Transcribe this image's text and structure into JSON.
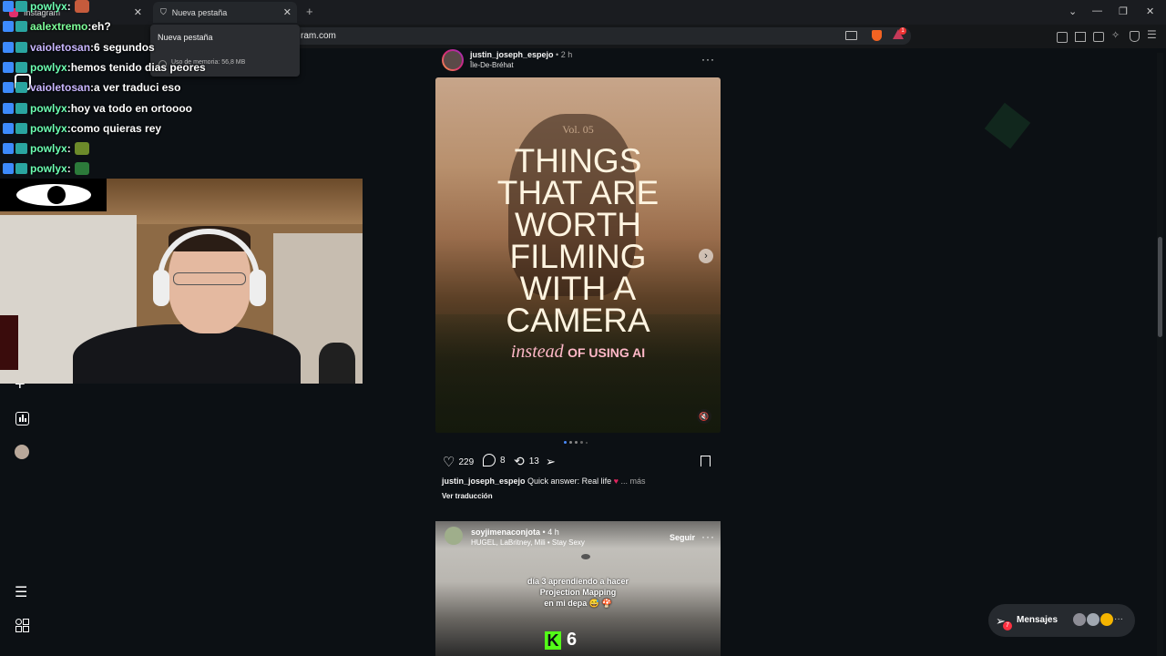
{
  "browser": {
    "tabs": [
      {
        "label": "Instagram"
      },
      {
        "label": "Nueva pestaña"
      }
    ],
    "url": "ram.com",
    "tooltip": {
      "title": "Nueva pestaña",
      "memory": "Uso de memoria: 56,8 MB"
    },
    "extension_badge": "1"
  },
  "chat": [
    {
      "user": "powlyx",
      "sep": " :",
      "msg": "",
      "emote": "#c55b3c"
    },
    {
      "user": "aalextremo",
      "sep": " :",
      "msg": " eh?"
    },
    {
      "user": "vaioletosan",
      "sep": " :",
      "msg": " 6 segundos"
    },
    {
      "user": "powlyx",
      "sep": " :",
      "msg": " hemos tenido dias peores"
    },
    {
      "user": "vaioletosan",
      "sep": " :",
      "msg": " a ver traduci eso"
    },
    {
      "user": "powlyx",
      "sep": " :",
      "msg": " hoy va todo en ortoooo"
    },
    {
      "user": "powlyx",
      "sep": " :",
      "msg": " como quieras rey"
    },
    {
      "user": "powlyx",
      "sep": " :",
      "msg": "",
      "emote": "#6c8a2a"
    },
    {
      "user": "powlyx",
      "sep": " :",
      "msg": "",
      "emote": "#2c7a3a"
    }
  ],
  "user_colors": {
    "powlyx": "#6dffb3",
    "aalextremo": "#7dff9a",
    "vaioletosan": "#c9b6ff"
  },
  "rail_icons": [
    "create-icon",
    "insights-icon",
    "profile-avatar",
    "menu-icon",
    "more-apps-icon"
  ],
  "post1": {
    "username": "justin_joseph_espejo",
    "time": "2 h",
    "location": "Île-De-Bréhat",
    "media": {
      "vol": "Vol. 05",
      "lines": [
        "THINGS",
        "THAT ARE",
        "WORTH",
        "FILMING",
        "WITH A",
        "CAMERA"
      ],
      "instead": "instead",
      "using_ai": "OF USING AI"
    },
    "likes": "229",
    "comments": "8",
    "reposts": "13",
    "caption_user": "justin_joseph_espejo",
    "caption_text": "Quick answer: Real life",
    "caption_more": "... más",
    "translate": "Ver traducción"
  },
  "post2": {
    "username": "soyjimenaconjota",
    "time": "4 h",
    "music": "HUGEL, LaBritney, Mili • Stay Sexy",
    "follow": "Seguir",
    "overlay_lines": [
      "día 3 aprendiendo a hacer",
      "Projection Mapping",
      "en mi depa 😅 🍄"
    ],
    "kick_count": "6"
  },
  "messages": {
    "label": "Mensajes",
    "badge": "7"
  }
}
